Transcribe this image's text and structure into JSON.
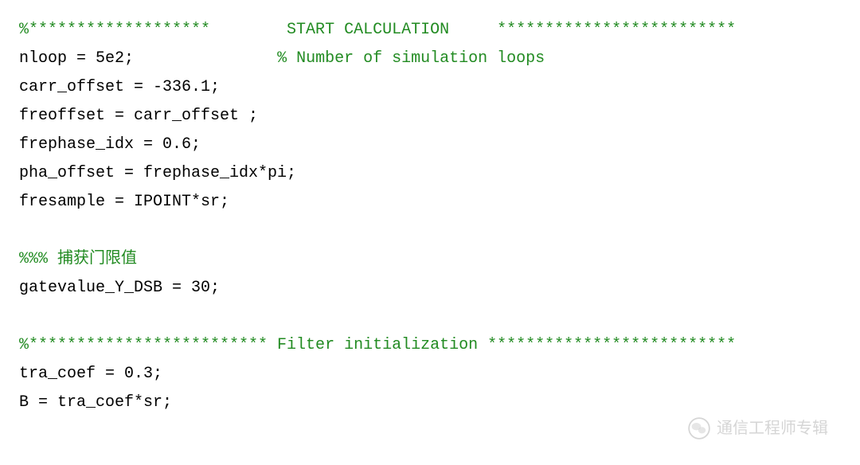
{
  "lines": [
    {
      "segments": [
        {
          "type": "comment",
          "text": "%*******************        START CALCULATION     *************************"
        }
      ]
    },
    {
      "segments": [
        {
          "type": "code",
          "text": "nloop = 5e2;               "
        },
        {
          "type": "comment",
          "text": "% Number of simulation loops"
        }
      ]
    },
    {
      "segments": [
        {
          "type": "code",
          "text": "carr_offset = -336.1;"
        }
      ]
    },
    {
      "segments": [
        {
          "type": "code",
          "text": "freoffset = carr_offset ;"
        }
      ]
    },
    {
      "segments": [
        {
          "type": "code",
          "text": "frephase_idx = 0.6;"
        }
      ]
    },
    {
      "segments": [
        {
          "type": "code",
          "text": "pha_offset = frephase_idx*pi;"
        }
      ]
    },
    {
      "segments": [
        {
          "type": "code",
          "text": "fresample = IPOINT*sr;"
        }
      ]
    },
    {
      "segments": [
        {
          "type": "code",
          "text": ""
        }
      ]
    },
    {
      "segments": [
        {
          "type": "comment",
          "text": "%%% 捕获门限值"
        }
      ]
    },
    {
      "segments": [
        {
          "type": "code",
          "text": "gatevalue_Y_DSB = 30;"
        }
      ]
    },
    {
      "segments": [
        {
          "type": "code",
          "text": ""
        }
      ]
    },
    {
      "segments": [
        {
          "type": "comment",
          "text": "%************************* Filter initialization **************************"
        }
      ]
    },
    {
      "segments": [
        {
          "type": "code",
          "text": "tra_coef = 0.3;"
        }
      ]
    },
    {
      "segments": [
        {
          "type": "code",
          "text": "B = tra_coef*sr;"
        }
      ]
    }
  ],
  "watermark": {
    "text": "通信工程师专辑"
  }
}
